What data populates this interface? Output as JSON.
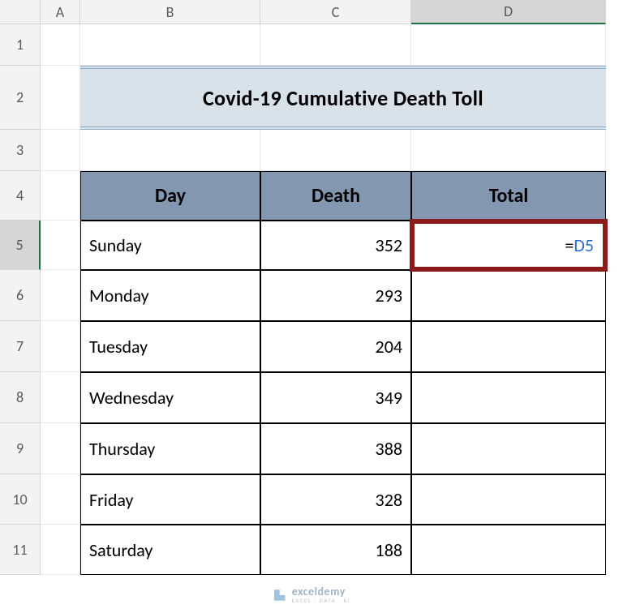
{
  "columns": [
    "A",
    "B",
    "C",
    "D"
  ],
  "rows": [
    "1",
    "2",
    "3",
    "4",
    "5",
    "6",
    "7",
    "8",
    "9",
    "10",
    "11"
  ],
  "active_col": "D",
  "active_row": "5",
  "title": "Covid-19 Cumulative Death Toll",
  "headers": {
    "day": "Day",
    "death": "Death",
    "total": "Total"
  },
  "table": [
    {
      "day": "Sunday",
      "death": "352"
    },
    {
      "day": "Monday",
      "death": "293"
    },
    {
      "day": "Tuesday",
      "death": "204"
    },
    {
      "day": "Wednesday",
      "death": "349"
    },
    {
      "day": "Thursday",
      "death": "388"
    },
    {
      "day": "Friday",
      "death": "328"
    },
    {
      "day": "Saturday",
      "death": "188"
    }
  ],
  "formula_prefix": "=",
  "formula_ref": "D5",
  "watermark": {
    "name": "exceldemy",
    "tagline": "EXCEL · DATA · BI"
  }
}
